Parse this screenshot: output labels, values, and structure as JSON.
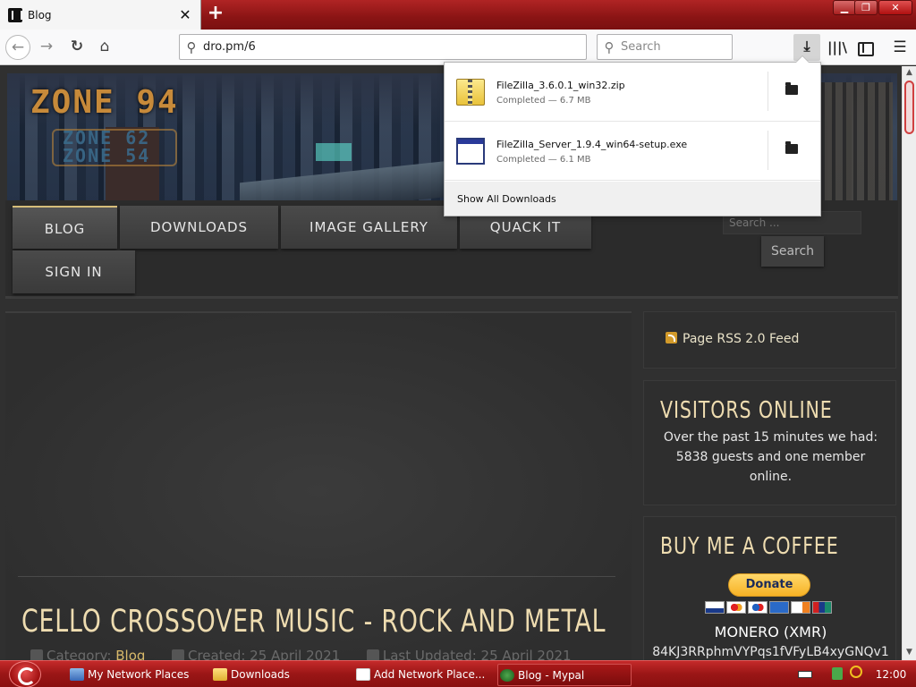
{
  "browser": {
    "tab_title": "Blog",
    "tab_close": "✕",
    "new_tab": "+",
    "url": "dro.pm/6",
    "search_placeholder": "Search",
    "window_buttons": {
      "minimize": "▁",
      "maximize": "❐",
      "close": "✕"
    },
    "toolbar_glyphs": {
      "back": "←",
      "forward": "→",
      "reload": "↻",
      "home": "⌂",
      "downloads": "⤓",
      "library": "|||\\",
      "menu": "☰",
      "url_search": "⚲",
      "search": "⚲"
    }
  },
  "banner": {
    "logo_main": "ZONE 94",
    "logo_sub1": "ZONE 62",
    "logo_sub2": "ZONE 54"
  },
  "nav_menu": {
    "items": [
      "BLOG",
      "DOWNLOADS",
      "IMAGE GALLERY",
      "QUACK IT",
      "SIGN IN"
    ],
    "active": "BLOG"
  },
  "site_search": {
    "placeholder": "Search ...",
    "button": "Search"
  },
  "article": {
    "title": "CELLO CROSSOVER MUSIC - ROCK AND METAL",
    "category_label": "Category:",
    "category_value": "Blog",
    "created": "Created: 25 April 2021",
    "updated": "Last Updated: 25 April 2021"
  },
  "sidebar": {
    "rss": "Page RSS 2.0 Feed",
    "visitors_title": "VISITORS ONLINE",
    "visitors_text": "Over the past 15 minutes we had: 5838 guests and one member online.",
    "coffee_title": "BUY ME A COFFEE",
    "donate": "Donate",
    "monero_label": "MONERO (XMR)",
    "monero_address": "84KJ3RRphmVYPqs1fVFyLB4xyGNQv1"
  },
  "downloads_panel": {
    "items": [
      {
        "name": "FileZilla_3.6.0.1_win32.zip",
        "status": "Completed — 6.7 MB",
        "icon": "zip-file-icon"
      },
      {
        "name": "FileZilla_Server_1.9.4_win64-setup.exe",
        "status": "Completed — 6.1 MB",
        "icon": "exe-file-icon"
      }
    ],
    "show_all": "Show All Downloads"
  },
  "taskbar": {
    "tasks": [
      "My Network Places",
      "Downloads",
      "Add Network Place...",
      "Blog - Mypal"
    ],
    "active_task": "Blog - Mypal",
    "clock": "12:00 AM"
  },
  "colors": {
    "taskbar_red": "#9a1616",
    "accent_gold": "#eedcb0",
    "link_gold": "#d8b96a",
    "donate_yellow": "#f7b225"
  }
}
